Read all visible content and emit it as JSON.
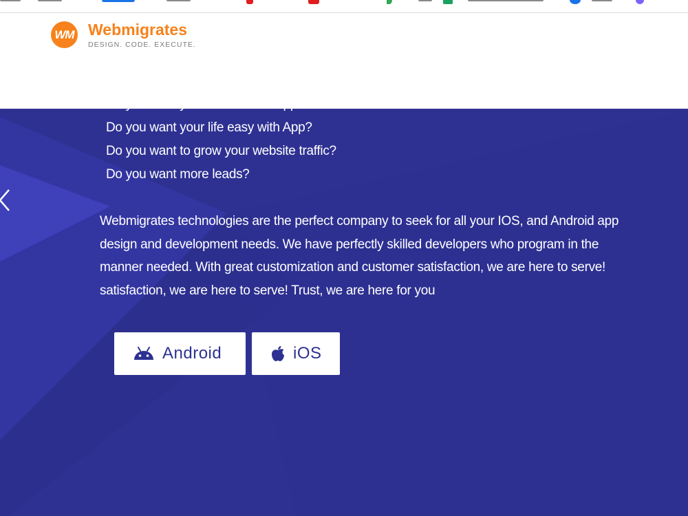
{
  "header": {
    "logo_mark": "WM",
    "brand_name": "Webmigrates",
    "tagline": "DESIGN. CODE. EXECUTE."
  },
  "hero": {
    "questions": [
      "Do you want your own mobile App?",
      "Do you want your life easy with App?",
      "Do you want to grow your website traffic?",
      "Do you want more leads?"
    ],
    "paragraph_lines": [
      "Webmigrates technologies are the perfect company to seek for all your IOS, and Android app",
      "design and development needs. We have perfectly skilled developers who program in the",
      "manner needed. With great customization and customer satisfaction, we are here to serve!",
      "satisfaction, we are here to serve! Trust, we are here for you"
    ],
    "buttons": {
      "android": "Android",
      "ios": "iOS"
    }
  },
  "icons": {
    "android": "android-icon",
    "apple": "apple-icon",
    "prev": "chevron-left-icon"
  },
  "colors": {
    "hero_bg": "#2e3192",
    "brand_orange": "#f7821b",
    "button_text": "#2e3192"
  }
}
